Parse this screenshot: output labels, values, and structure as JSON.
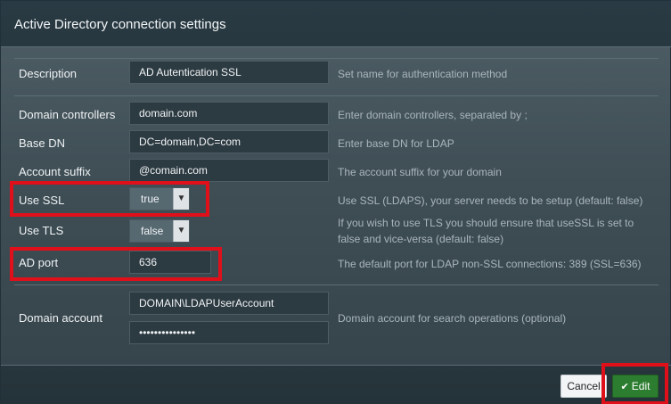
{
  "dialog": {
    "title": "Active Directory connection settings"
  },
  "form": {
    "description": {
      "label": "Description",
      "value": "AD Autentication SSL",
      "hint": "Set name for authentication method"
    },
    "domain_controllers": {
      "label": "Domain controllers",
      "value": "domain.com",
      "hint": "Enter domain controllers, separated by ;"
    },
    "base_dn": {
      "label": "Base DN",
      "value": "DC=domain,DC=com",
      "hint": "Enter base DN for LDAP"
    },
    "account_suffix": {
      "label": "Account suffix",
      "value": "@comain.com",
      "hint": "The account suffix for your domain"
    },
    "use_ssl": {
      "label": "Use SSL",
      "value": "true",
      "hint": "Use SSL (LDAPS), your server needs to be setup (default: false)"
    },
    "use_tls": {
      "label": "Use TLS",
      "value": "false",
      "hint": "If you wish to use TLS you should ensure that useSSL is set to false and vice-versa (default: false)"
    },
    "ad_port": {
      "label": "AD port",
      "value": "636",
      "hint": "The default port for LDAP non-SSL connections: 389 (SSL=636)"
    },
    "domain_account": {
      "label": "Domain account",
      "username": "DOMAIN\\LDAPUserAccount",
      "password": "•••••••••••••••",
      "hint": "Domain account for search operations (optional)"
    }
  },
  "footer": {
    "cancel_label": "Cancel",
    "edit_label": "Edit",
    "edit_icon": "check-icon"
  },
  "colors": {
    "highlight": "#e0101b",
    "edit_button": "#2c7d2f"
  }
}
